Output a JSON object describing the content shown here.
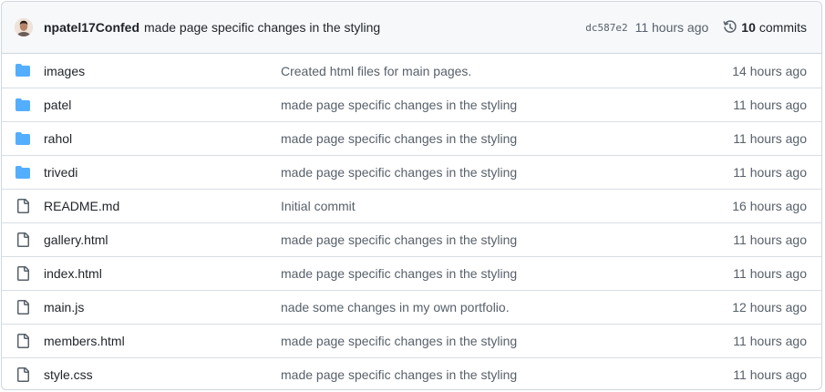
{
  "latest_commit": {
    "author": "npatel17Confed",
    "message": "made page specific changes in the styling",
    "sha": "dc587e2",
    "time": "11 hours ago",
    "commit_count": "10",
    "commits_label": "commits"
  },
  "files": [
    {
      "type": "dir",
      "icon": "folder-icon",
      "name": "images",
      "message": "Created html files for main pages.",
      "time": "14 hours ago"
    },
    {
      "type": "dir",
      "icon": "folder-icon",
      "name": "patel",
      "message": "made page specific changes in the styling",
      "time": "11 hours ago"
    },
    {
      "type": "dir",
      "icon": "folder-icon",
      "name": "rahol",
      "message": "made page specific changes in the styling",
      "time": "11 hours ago"
    },
    {
      "type": "dir",
      "icon": "folder-icon",
      "name": "trivedi",
      "message": "made page specific changes in the styling",
      "time": "11 hours ago"
    },
    {
      "type": "file",
      "icon": "file-icon",
      "name": "README.md",
      "message": "Initial commit",
      "time": "16 hours ago"
    },
    {
      "type": "file",
      "icon": "file-icon",
      "name": "gallery.html",
      "message": "made page specific changes in the styling",
      "time": "11 hours ago"
    },
    {
      "type": "file",
      "icon": "file-icon",
      "name": "index.html",
      "message": "made page specific changes in the styling",
      "time": "11 hours ago"
    },
    {
      "type": "file",
      "icon": "file-icon",
      "name": "main.js",
      "message": "nade some changes in my own portfolio.",
      "time": "12 hours ago"
    },
    {
      "type": "file",
      "icon": "file-icon",
      "name": "members.html",
      "message": "made page specific changes in the styling",
      "time": "11 hours ago"
    },
    {
      "type": "file",
      "icon": "file-icon",
      "name": "style.css",
      "message": "made page specific changes in the styling",
      "time": "11 hours ago"
    }
  ],
  "colors": {
    "folder": "#54aeff",
    "file": "#57606a",
    "border": "#d0d7de",
    "header_bg": "#f6f8fa",
    "muted_text": "#57606a"
  }
}
